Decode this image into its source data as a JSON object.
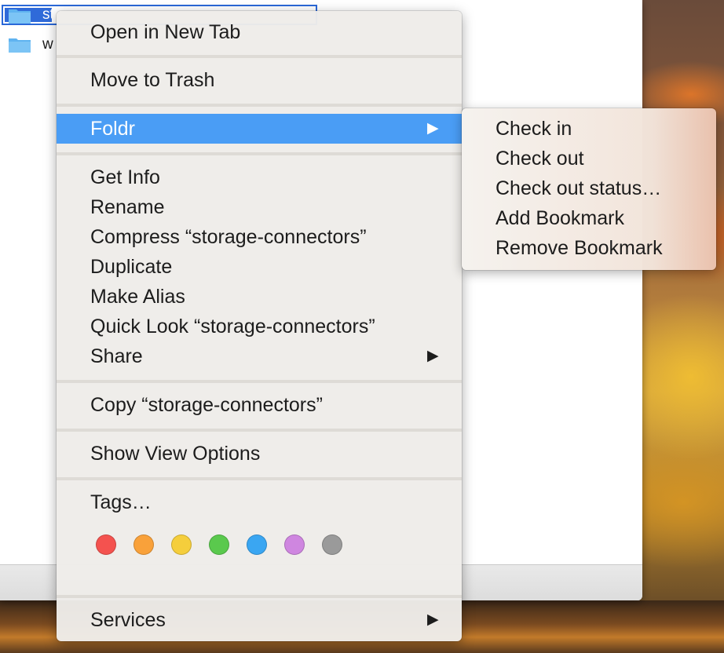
{
  "finder": {
    "files": [
      {
        "name": "storage-connectors",
        "visible_text": "st",
        "selected": true
      },
      {
        "name": "w",
        "visible_text": "w",
        "selected": false
      }
    ]
  },
  "context_menu": {
    "open_new_tab": "Open in New Tab",
    "move_to_trash": "Move to Trash",
    "foldr": "Foldr",
    "get_info": "Get Info",
    "rename": "Rename",
    "compress": "Compress “storage-connectors”",
    "duplicate": "Duplicate",
    "make_alias": "Make Alias",
    "quick_look": "Quick Look “storage-connectors”",
    "share": "Share",
    "copy": "Copy “storage-connectors”",
    "show_view_options": "Show View Options",
    "tags": "Tags…",
    "services": "Services",
    "submenu_arrow": "▶",
    "tag_colors": [
      {
        "name": "red",
        "color": "#f4524f"
      },
      {
        "name": "orange",
        "color": "#f9a13a"
      },
      {
        "name": "yellow",
        "color": "#f5ce3c"
      },
      {
        "name": "green",
        "color": "#5ac94d"
      },
      {
        "name": "blue",
        "color": "#3aa6f2"
      },
      {
        "name": "purple",
        "color": "#cf86e0"
      },
      {
        "name": "gray",
        "color": "#9a9a9a"
      }
    ]
  },
  "foldr_submenu": {
    "check_in": "Check in",
    "check_out": "Check out",
    "check_out_status": "Check out status…",
    "add_bookmark": "Add Bookmark",
    "remove_bookmark": "Remove Bookmark"
  },
  "colors": {
    "highlight": "#4a9df5",
    "selection": "#2f6ad9",
    "folder": "#5fb3f0"
  }
}
